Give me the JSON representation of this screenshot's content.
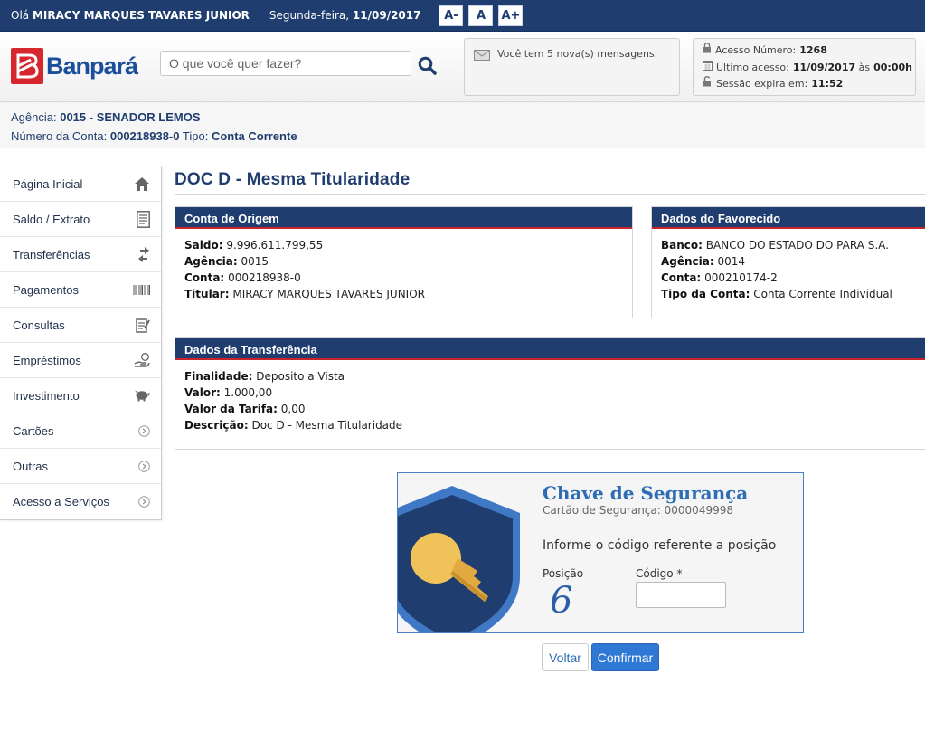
{
  "topbar": {
    "greeting_prefix": "Olá",
    "user_name": "MIRACY MARQUES TAVARES JUNIOR",
    "weekday": "Segunda-feira,",
    "date": "11/09/2017",
    "font_buttons": [
      "A-",
      "A",
      "A+"
    ]
  },
  "header": {
    "logo_text": "Banpará",
    "search_placeholder": "O que você quer fazer?",
    "messages_text": "Você tem 5 nova(s) mensagens.",
    "session": {
      "access_label": "Acesso Número:",
      "access_number": "1268",
      "last_access_label": "Último acesso:",
      "last_access_date": "11/09/2017",
      "last_access_at": "às",
      "last_access_time": "00:00h",
      "expires_label": "Sessão expira em:",
      "expires_value": "11:52"
    }
  },
  "account": {
    "agency_label": "Agência:",
    "agency_value": "0015 - SENADOR LEMOS",
    "account_label": "Número da Conta:",
    "account_value": "000218938-0",
    "type_label": "Tipo:",
    "type_value": "Conta Corrente"
  },
  "sidebar": {
    "items": [
      {
        "label": "Página Inicial",
        "icon": "home-icon"
      },
      {
        "label": "Saldo / Extrato",
        "icon": "document-icon"
      },
      {
        "label": "Transferências",
        "icon": "transfer-icon"
      },
      {
        "label": "Pagamentos",
        "icon": "barcode-icon"
      },
      {
        "label": "Consultas",
        "icon": "clipboard-icon"
      },
      {
        "label": "Empréstimos",
        "icon": "hand-coin-icon"
      },
      {
        "label": "Investimento",
        "icon": "piggy-bank-icon"
      },
      {
        "label": "Cartões",
        "icon": "chevron-right-icon"
      },
      {
        "label": "Outras",
        "icon": "chevron-right-icon"
      },
      {
        "label": "Acesso a Serviços",
        "icon": "chevron-right-icon"
      }
    ]
  },
  "main": {
    "title": "DOC D - Mesma Titularidade",
    "origin": {
      "heading": "Conta de Origem",
      "saldo_label": "Saldo:",
      "saldo": "9.996.611.799,55",
      "agencia_label": "Agência:",
      "agencia": "0015",
      "conta_label": "Conta:",
      "conta": "000218938-0",
      "titular_label": "Titular:",
      "titular": "MIRACY MARQUES TAVARES JUNIOR"
    },
    "favorecido": {
      "heading": "Dados do Favorecido",
      "banco_label": "Banco:",
      "banco": "BANCO DO ESTADO DO PARA S.A.",
      "agencia_label": "Agência:",
      "agencia": "0014",
      "conta_label": "Conta:",
      "conta": "000210174-2",
      "tipo_label": "Tipo da Conta:",
      "tipo": "Conta Corrente Individual"
    },
    "transfer": {
      "heading": "Dados da Transferência",
      "finalidade_label": "Finalidade:",
      "finalidade": "Deposito a Vista",
      "valor_label": "Valor:",
      "valor": "1.000,00",
      "tarifa_label": "Valor da Tarifa:",
      "tarifa": "0,00",
      "descricao_label": "Descrição:",
      "descricao": "Doc D - Mesma Titularidade"
    },
    "security": {
      "title": "Chave de Segurança",
      "card_label": "Cartão de Segurança:",
      "card_number": "0000049998",
      "instruction": "Informe o código referente a posição",
      "position_label": "Posição",
      "position_value": "6",
      "code_label": "Código *",
      "code_value": ""
    },
    "buttons": {
      "back": "Voltar",
      "confirm": "Confirmar"
    }
  },
  "colors": {
    "brand_navy": "#1f3d6e",
    "brand_red": "#d6262e",
    "link_blue": "#2e6db4",
    "confirm_blue": "#2f78d3"
  }
}
